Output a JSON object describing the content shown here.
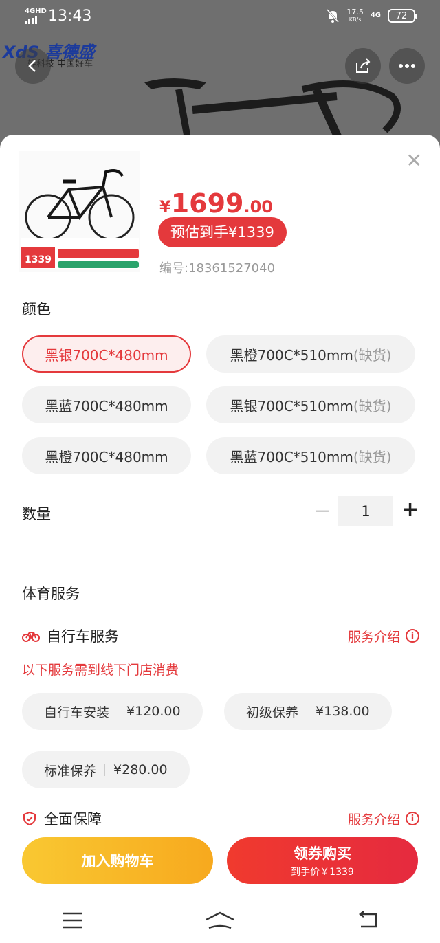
{
  "status_bar": {
    "network": "4GHD",
    "time": "13:43",
    "speed": "17.5",
    "speed_unit": "KB/s",
    "signal": "4G",
    "battery": "72"
  },
  "hero": {
    "brand_name": "XdS 喜德盛",
    "brand_tagline": "轻科技 中国好车"
  },
  "product": {
    "price_symbol": "¥",
    "price_integer": "1699",
    "price_decimal": ".00",
    "estimated_price": "预估到手¥1339",
    "sku_number": "编号:18361527040",
    "thumb_promo_price": "1339"
  },
  "color": {
    "title": "颜色",
    "options": [
      {
        "label": "黑银700C*480mm",
        "suffix": "",
        "selected": true
      },
      {
        "label": "黑橙700C*510mm",
        "suffix": "(缺货)",
        "selected": false
      },
      {
        "label": "黑蓝700C*480mm",
        "suffix": "",
        "selected": false
      },
      {
        "label": "黑银700C*510mm",
        "suffix": "(缺货)",
        "selected": false
      },
      {
        "label": "黑橙700C*480mm",
        "suffix": "",
        "selected": false
      },
      {
        "label": "黑蓝700C*510mm",
        "suffix": "(缺货)",
        "selected": false
      }
    ]
  },
  "quantity": {
    "title": "数量",
    "minus": "−",
    "value": "1",
    "plus": "+"
  },
  "services": {
    "title": "体育服务",
    "bike_service": {
      "label": "自行车服务",
      "intro": "服务介绍"
    },
    "note": "以下服务需到线下门店消费",
    "items": [
      {
        "name": "自行车安装",
        "price": "¥120.00"
      },
      {
        "name": "初级保养",
        "price": "¥138.00"
      },
      {
        "name": "标准保养",
        "price": "¥280.00"
      }
    ],
    "protection": {
      "label": "全面保障",
      "intro": "服务介绍"
    }
  },
  "actions": {
    "add_to_cart": "加入购物车",
    "buy_main": "领券购买",
    "buy_sub": "到手价￥1339"
  },
  "colors": {
    "accent": "#e4393c",
    "cart_button": "#f7b325"
  }
}
